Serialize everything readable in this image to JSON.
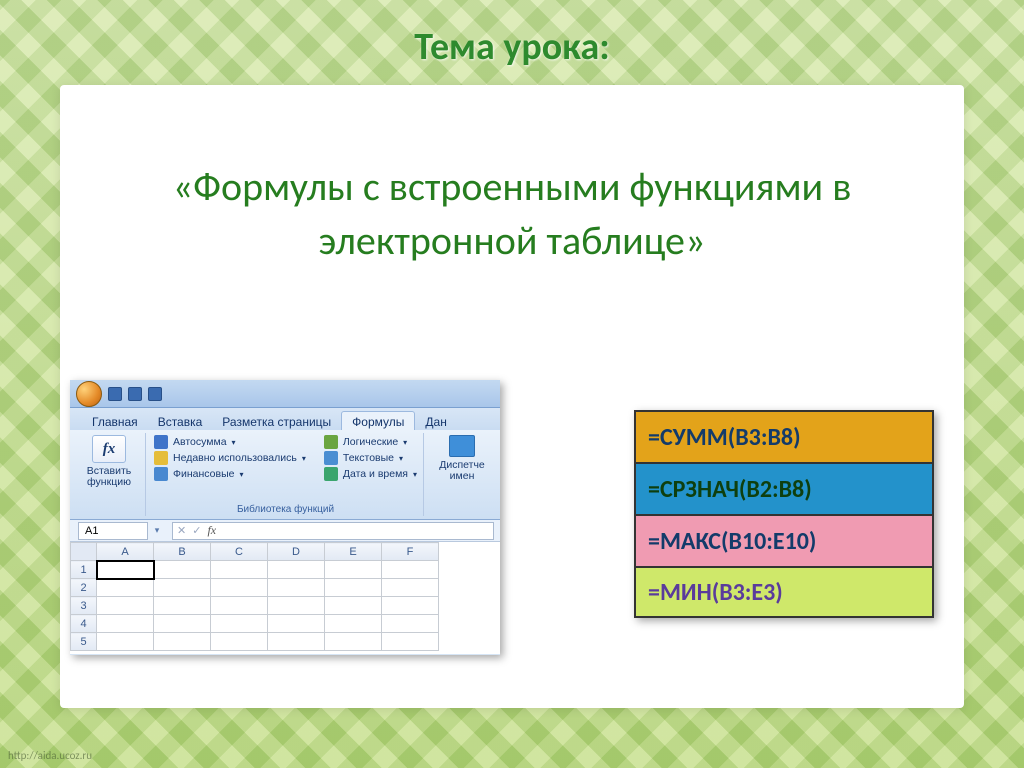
{
  "heading": "Тема урока:",
  "subtitle": "«Формулы с встроенными функциями в электронной таблице»",
  "excel": {
    "tabs": [
      "Главная",
      "Вставка",
      "Разметка страницы",
      "Формулы",
      "Дан"
    ],
    "active_tab_index": 3,
    "insert_fn": "Вставить\nфункцию",
    "lib_caption": "Библиотека функций",
    "cmds_left": [
      "Автосумма",
      "Недавно использовались",
      "Финансовые"
    ],
    "cmds_right": [
      "Логические",
      "Текстовые",
      "Дата и время"
    ],
    "name_mgr": "Диспетче\nимен",
    "namebox": "A1",
    "columns": [
      "A",
      "B",
      "C",
      "D",
      "E",
      "F"
    ],
    "rows": [
      "1",
      "2",
      "3",
      "4",
      "5"
    ]
  },
  "formulas": [
    "=СУММ(B3:B8)",
    "=СРЗНАЧ(B2:B8)",
    "=МАКС(B10:E10)",
    "=МИН(B3:E3)"
  ],
  "footer": "http://aida.ucoz.ru"
}
